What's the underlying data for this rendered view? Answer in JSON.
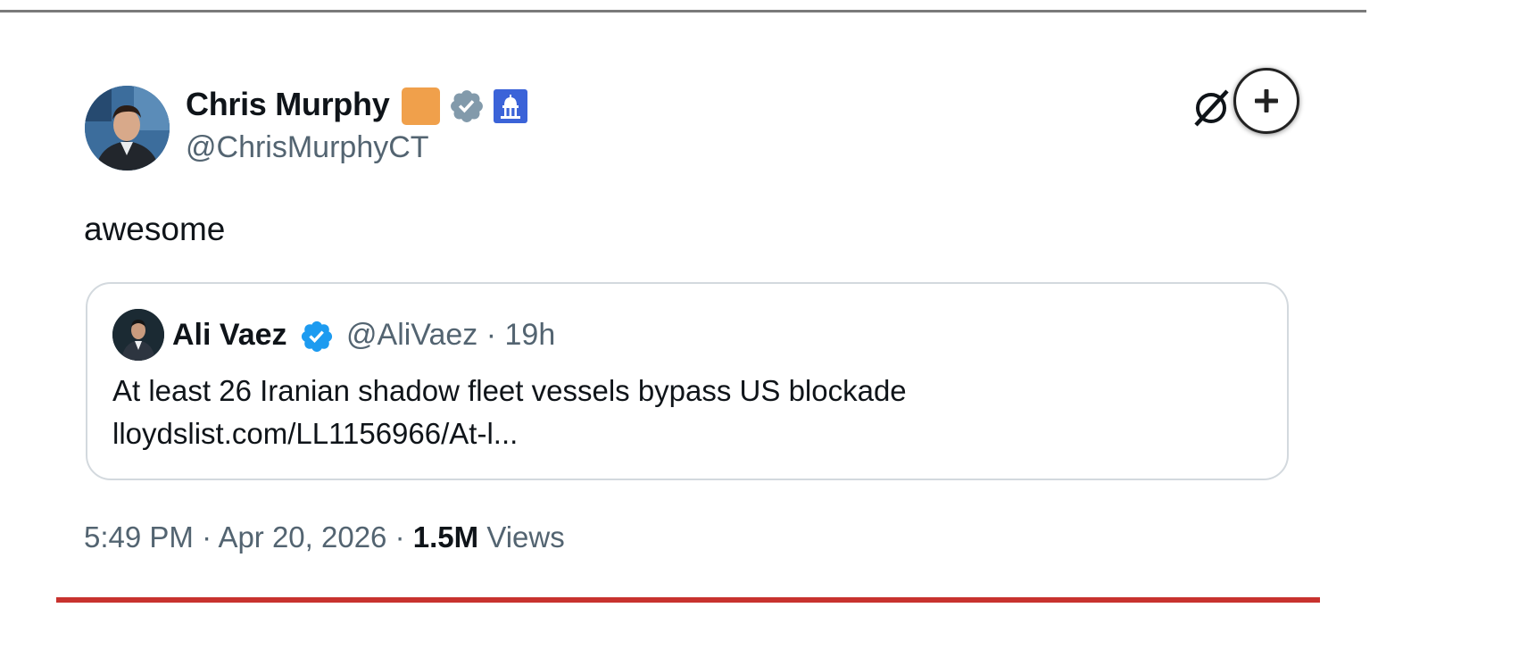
{
  "author": {
    "display_name": "Chris Murphy",
    "handle": "@ChrisMurphyCT",
    "badge_color": "#f0a04b",
    "verified_color": "#829aab"
  },
  "tweet": {
    "text": "awesome"
  },
  "quoted_tweet": {
    "display_name": "Ali Vaez",
    "handle": "@AliVaez",
    "separator": "·",
    "age": "19h",
    "text": "At least 26 Iranian shadow fleet vessels bypass US blockade",
    "link": "lloydslist.com/LL1156966/At-l..."
  },
  "meta": {
    "time": "5:49 PM",
    "separator": "·",
    "date": "Apr 20, 2026",
    "views_count": "1.5M",
    "views_label": "Views"
  },
  "colors": {
    "accent_blue": "#1d9bf0",
    "secondary_text": "#536471",
    "border": "#d3d9de",
    "bottom_rule": "#c8322e"
  }
}
